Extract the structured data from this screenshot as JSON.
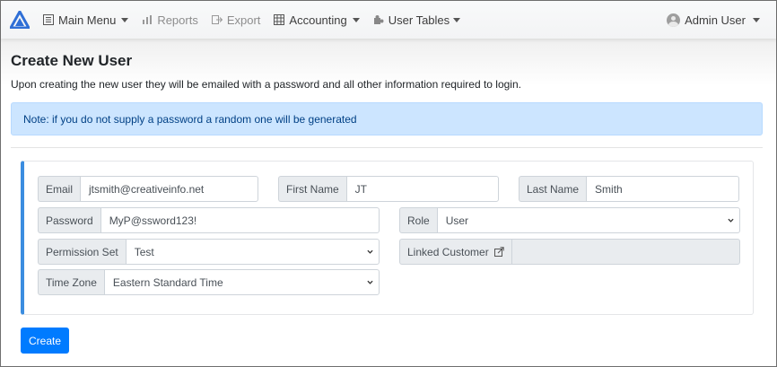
{
  "nav": {
    "main_menu": "Main Menu",
    "reports": "Reports",
    "export": "Export",
    "accounting": "Accounting",
    "user_tables": "User Tables",
    "user": "Admin User"
  },
  "page": {
    "title": "Create New User",
    "subtitle": "Upon creating the new user they will be emailed with a password and all other information required to login.",
    "alert": "Note: if you do not supply a password a random one will be generated"
  },
  "form": {
    "email_label": "Email",
    "email_value": "jtsmith@creativeinfo.net",
    "first_name_label": "First Name",
    "first_name_value": "JT",
    "last_name_label": "Last Name",
    "last_name_value": "Smith",
    "password_label": "Password",
    "password_value": "MyP@ssword123!",
    "role_label": "Role",
    "role_value": "User",
    "permission_label": "Permission Set",
    "permission_value": "Test",
    "linked_customer_label": "Linked Customer",
    "linked_customer_value": "",
    "timezone_label": "Time Zone",
    "timezone_value": "Eastern Standard Time"
  },
  "buttons": {
    "create": "Create"
  },
  "colors": {
    "primary": "#007bff",
    "alert_bg": "#cce5ff",
    "card_accent": "#3b8de0"
  },
  "icons": {
    "brand": "triangle-logo-icon",
    "main_menu": "list-icon",
    "reports": "bar-chart-icon",
    "export": "export-icon",
    "accounting": "table-icon",
    "user_tables": "puzzle-icon",
    "user": "user-avatar-icon",
    "linked_customer": "external-link-icon"
  }
}
